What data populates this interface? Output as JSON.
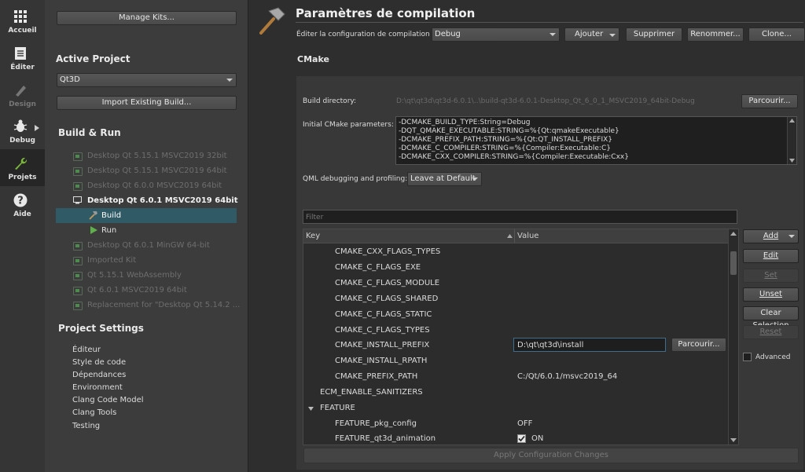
{
  "modebar": {
    "items": [
      {
        "label": "Accueil",
        "icon": "grid-icon",
        "enabled": true
      },
      {
        "label": "Éditer",
        "icon": "document-icon",
        "enabled": true
      },
      {
        "label": "Design",
        "icon": "pen-icon",
        "enabled": false
      },
      {
        "label": "Debug",
        "icon": "bug-icon",
        "enabled": true
      },
      {
        "label": "Projets",
        "icon": "wrench-icon",
        "enabled": true,
        "active": true
      },
      {
        "label": "Aide",
        "icon": "help-icon",
        "enabled": true
      }
    ]
  },
  "left": {
    "manage_kits": "Manage Kits...",
    "active_project_title": "Active Project",
    "project_value": "Qt3D",
    "import_build": "Import Existing Build...",
    "build_run_title": "Build & Run",
    "kits": [
      {
        "label": "Desktop Qt 5.15.1 MSVC2019 32bit"
      },
      {
        "label": "Desktop Qt 5.15.1 MSVC2019 64bit"
      },
      {
        "label": "Desktop Qt 6.0.0 MSVC2019 64bit"
      }
    ],
    "active_kit": "Desktop Qt 6.0.1 MSVC2019 64bit",
    "build_label": "Build",
    "run_label": "Run",
    "kits_after": [
      {
        "label": "Desktop Qt 6.0.1 MinGW 64-bit"
      },
      {
        "label": "Imported Kit"
      },
      {
        "label": "Qt 5.15.1 WebAssembly"
      },
      {
        "label": "Qt 6.0.1 MSVC2019 64bit"
      },
      {
        "label": "Replacement for \"Desktop Qt 5.14.2 ..."
      }
    ],
    "project_settings_title": "Project Settings",
    "settings": [
      "Éditeur",
      "Style de code",
      "Dépendances",
      "Environment",
      "Clang Code Model",
      "Clang Tools",
      "Testing"
    ]
  },
  "main": {
    "title": "Paramètres de compilation",
    "edit_config_label": "Éditer la configuration de compilation :",
    "config_value": "Debug",
    "buttons": {
      "add": "Ajouter",
      "remove": "Supprimer",
      "rename": "Renommer...",
      "clone": "Clone..."
    },
    "cmake_title": "CMake",
    "build_dir_label": "Build directory:",
    "build_dir_value": "D:\\qt\\qt3d\\qt3d-6.0.1\\..\\build-qt3d-6.0.1-Desktop_Qt_6_0_1_MSVC2019_64bit-Debug",
    "browse": "Parcourir...",
    "initial_params_label": "Initial CMake parameters:",
    "initial_params": [
      "-DCMAKE_BUILD_TYPE:String=Debug",
      "-DQT_QMAKE_EXECUTABLE:STRING=%{Qt:qmakeExecutable}",
      "-DCMAKE_PREFIX_PATH:STRING=%{Qt:QT_INSTALL_PREFIX}",
      "-DCMAKE_C_COMPILER:STRING=%{Compiler:Executable:C}",
      "-DCMAKE_CXX_COMPILER:STRING=%{Compiler:Executable:Cxx}"
    ],
    "qml_label": "QML debugging and profiling:",
    "qml_value": "Leave at Default",
    "filter_placeholder": "Filter",
    "col_key": "Key",
    "col_value": "Value",
    "rows": [
      {
        "key": "CMAKE_CXX_FLAGS_TYPES",
        "value": "",
        "indent": 2
      },
      {
        "key": "CMAKE_C_FLAGS_EXE",
        "value": "",
        "indent": 2
      },
      {
        "key": "CMAKE_C_FLAGS_MODULE",
        "value": "",
        "indent": 2
      },
      {
        "key": "CMAKE_C_FLAGS_SHARED",
        "value": "",
        "indent": 2
      },
      {
        "key": "CMAKE_C_FLAGS_STATIC",
        "value": "",
        "indent": 2
      },
      {
        "key": "CMAKE_C_FLAGS_TYPES",
        "value": "",
        "indent": 2
      },
      {
        "key": "CMAKE_INSTALL_PREFIX",
        "value": "D:\\qt\\qt3d\\install",
        "indent": 2,
        "editing": true
      },
      {
        "key": "CMAKE_INSTALL_RPATH",
        "value": "",
        "indent": 2
      },
      {
        "key": "CMAKE_PREFIX_PATH",
        "value": "C:/Qt/6.0.1/msvc2019_64",
        "indent": 2
      },
      {
        "key": "ECM_ENABLE_SANITIZERS",
        "value": "",
        "indent": 1
      },
      {
        "key": "FEATURE",
        "value": "",
        "indent": 0,
        "expanded": true
      },
      {
        "key": "FEATURE_pkg_config",
        "value": "OFF",
        "indent": 2
      },
      {
        "key": "FEATURE_qt3d_animation",
        "value": "ON",
        "indent": 2,
        "checkbox": true
      }
    ],
    "edit_browse": "Parcourir...",
    "side_buttons": {
      "add": "Add",
      "edit": "Edit",
      "set": "Set",
      "unset": "Unset",
      "clear": "Clear Selection",
      "reset": "Reset"
    },
    "advanced_label": "Advanced",
    "apply": "Apply Configuration Changes"
  }
}
